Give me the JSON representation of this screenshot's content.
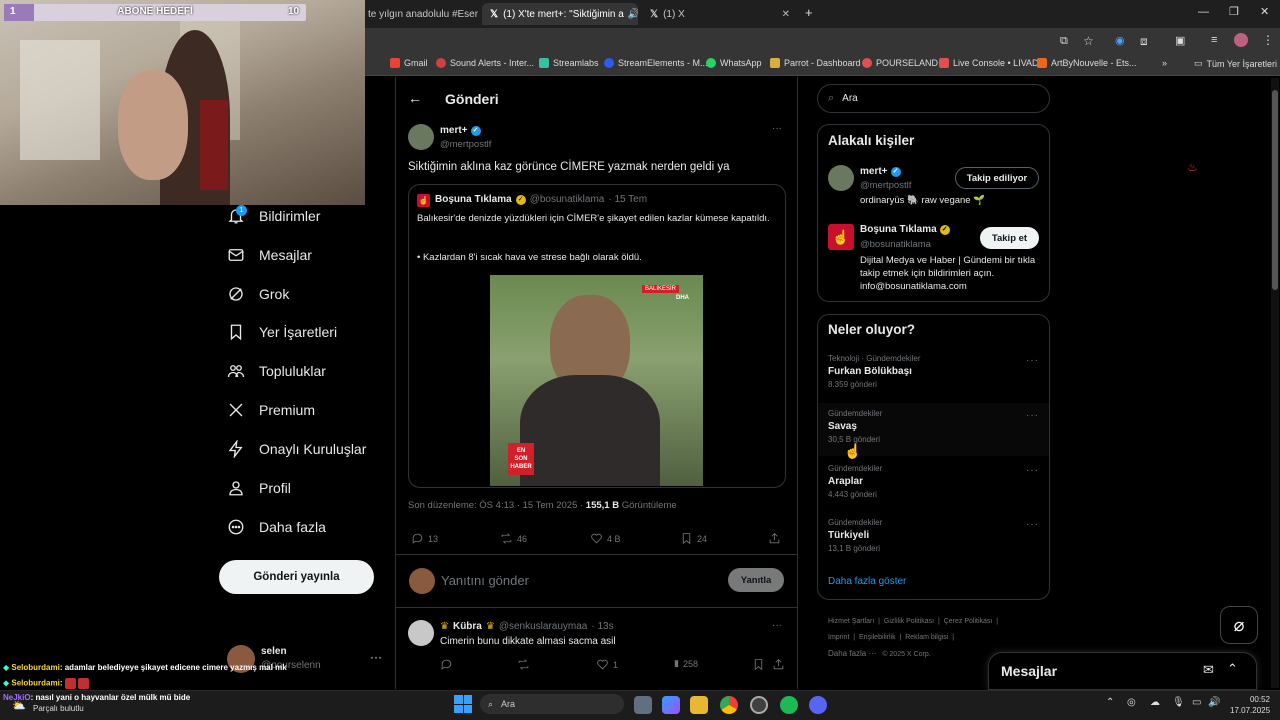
{
  "browser": {
    "tabs": [
      {
        "label": "te yılgın anadolulu #Esenk"
      },
      {
        "label": "(1) X'te mert+: \"Siktiğimin a"
      },
      {
        "label": "(1) X"
      }
    ],
    "new_tab": "+",
    "bookmarks": [
      {
        "label": "Gmail"
      },
      {
        "label": "Sound Alerts - Inter..."
      },
      {
        "label": "Streamlabs"
      },
      {
        "label": "StreamElements - M..."
      },
      {
        "label": "WhatsApp"
      },
      {
        "label": "Parrot - Dashboard"
      },
      {
        "label": "POURSELAND"
      },
      {
        "label": "Live Console • LIVAD"
      },
      {
        "label": "ArtByNouvelle - Ets..."
      },
      {
        "label": "Tüm Yer İşaretleri"
      }
    ]
  },
  "overlay": {
    "goal_left": "1",
    "goal_title": "ABONE HEDEFİ",
    "goal_right": "10"
  },
  "nav": {
    "items": [
      {
        "label": "Bildirimler",
        "badge": "1"
      },
      {
        "label": "Mesajlar"
      },
      {
        "label": "Grok"
      },
      {
        "label": "Yer İşaretleri"
      },
      {
        "label": "Topluluklar"
      },
      {
        "label": "Premium"
      },
      {
        "label": "Onaylı Kuruluşlar"
      },
      {
        "label": "Profil"
      },
      {
        "label": "Daha fazla"
      }
    ],
    "post_button": "Gönderi yayınla",
    "account_name": "selen",
    "account_handle": "@pourselenn"
  },
  "post": {
    "header_title": "Gönderi",
    "author_name": "mert+",
    "author_handle": "@mertpostlf",
    "text": "Siktiğimin aklına kaz görünce CİMERE yazmak nerden geldi ya",
    "quote": {
      "name": "Boşuna Tıklama",
      "handle": "@bosunatiklama",
      "time": "· 15 Tem",
      "text1": "Balıkesir'de denizde yüzdükleri için CİMER'e şikayet edilen kazlar kümese kapatıldı.",
      "text2": "• Kazlardan 8'i sıcak hava ve strese bağlı olarak öldü.",
      "media_tag": "BALIKESİR",
      "media_source": "DHA",
      "media_badge_1": "EN",
      "media_badge_2": "SON",
      "media_badge_3": "HABER"
    },
    "meta_prefix": "Son düzenleme: ÖS 4:13 · 15 Tem 2025 ·",
    "views_value": "155,1 B",
    "views_label": "Görüntüleme",
    "replies": "13",
    "reposts": "46",
    "likes": "4 B",
    "bookmarks": "24",
    "reply_placeholder": "Yanıtını gönder",
    "reply_button": "Yanıtla"
  },
  "reply": {
    "name": "Kübra",
    "handle": "@senkuslarauymaa",
    "time": "· 13s",
    "text": "Cimerin bunu dikkate almasi sacma asil",
    "reposts": "",
    "likes": "1",
    "views": "258"
  },
  "sidebar": {
    "search_placeholder": "Ara",
    "relevant_title": "Alakalı kişiler",
    "people": [
      {
        "name": "mert+",
        "handle": "@mertpostlf",
        "bio": "ordinaryüs 🐘 raw vegane 🌱",
        "button": "Takip ediliyor"
      },
      {
        "name": "Boşuna Tıklama",
        "handle": "@bosunatiklama",
        "bio": "Dijital Medya ve Haber | Gündemi bir tıkla takip etmek için bildirimleri açın. info@bosunatiklama.com",
        "button": "Takip et"
      }
    ],
    "trends_title": "Neler oluyor?",
    "trends": [
      {
        "category": "Teknoloji · Gündemdekiler",
        "name": "Furkan Bölükbaşı",
        "count": "8.359 gönderi"
      },
      {
        "category": "Gündemdekiler",
        "name": "Savaş",
        "count": "30,5 B gönderi"
      },
      {
        "category": "Gündemdekiler",
        "name": "Araplar",
        "count": "4.443 gönderi"
      },
      {
        "category": "Gündemdekiler",
        "name": "Türkiyeli",
        "count": "13,1 B gönderi"
      }
    ],
    "show_more": "Daha fazla göster",
    "footer_links": [
      "Hizmet Şartları",
      "Gizlilik Politikası",
      "Çerez Politikası",
      "Imprint",
      "Erişilebilirlik",
      "Reklam bilgisi",
      "Daha fazla ···",
      "© 2025 X Corp."
    ],
    "messages_title": "Mesajlar"
  },
  "chat": [
    {
      "user": "Seloburdami",
      "msg": ": adamlar belediyeye şikayet edicene cimere yazmış mal mk"
    },
    {
      "user": "Seloburdami",
      "msg": ":"
    },
    {
      "user": "NeJkiO",
      "msg": ": nasıl yani o hayvanlar özel mülk mü bide"
    }
  ],
  "taskbar": {
    "weather": "Parçalı bulutlu",
    "search": "Ara",
    "time": "00:52",
    "date": "17.07.2025"
  },
  "colors": {
    "accent": "#1d9bf0",
    "verified_gold": "#e2b719",
    "background": "#000000",
    "muted": "#71767b"
  }
}
